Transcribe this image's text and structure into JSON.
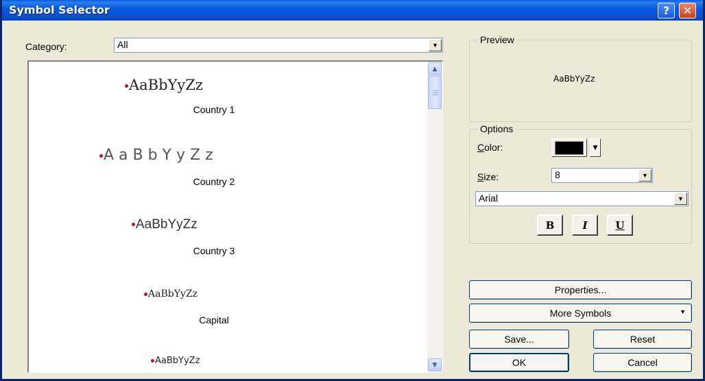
{
  "window": {
    "title": "Symbol Selector",
    "help_label": "?",
    "close_label": "✕"
  },
  "category": {
    "label": "Category:",
    "value": "All"
  },
  "symbols": [
    {
      "sample": "AaBbYyZz",
      "name": "Country 1"
    },
    {
      "sample": "A a B b Y y Z z",
      "name": "Country 2"
    },
    {
      "sample": "AaBbYyZz",
      "name": "Country 3"
    },
    {
      "sample": "AaBbYyZz",
      "name": "Capital"
    },
    {
      "sample": "AaBbYyZz",
      "name": ""
    }
  ],
  "preview": {
    "label": "Preview",
    "text": "AaBbYyZz"
  },
  "options": {
    "label": "Options",
    "color_label": "Color:",
    "color_value": "#000000",
    "size_label": "Size:",
    "size_value": "8",
    "font_value": "Arial",
    "bold_label": "B",
    "italic_label": "I",
    "underline_label": "U"
  },
  "buttons": {
    "properties": "Properties...",
    "more_symbols": "More Symbols",
    "save": "Save...",
    "reset": "Reset",
    "ok": "OK",
    "cancel": "Cancel"
  },
  "icons": {
    "dropdown": "▼",
    "scroll_up": "▲",
    "scroll_down": "▼"
  }
}
